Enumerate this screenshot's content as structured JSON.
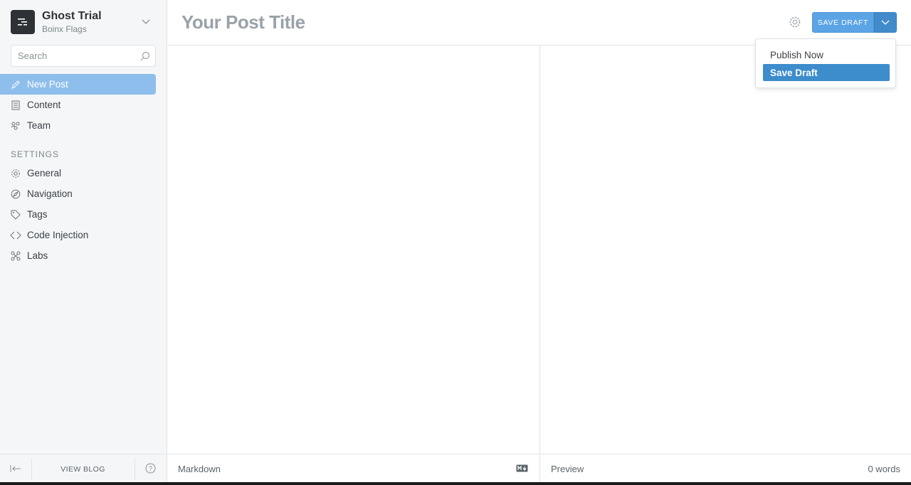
{
  "sidebar": {
    "blog_title": "Ghost Trial",
    "blog_subtitle": "Boinx Flags",
    "search_placeholder": "Search",
    "nav": [
      {
        "label": "New Post",
        "icon": "pencil-icon",
        "active": true
      },
      {
        "label": "Content",
        "icon": "document-icon"
      },
      {
        "label": "Team",
        "icon": "team-icon"
      }
    ],
    "settings_label": "SETTINGS",
    "settings_nav": [
      {
        "label": "General",
        "icon": "gear-icon"
      },
      {
        "label": "Navigation",
        "icon": "compass-icon"
      },
      {
        "label": "Tags",
        "icon": "tag-icon"
      },
      {
        "label": "Code Injection",
        "icon": "code-icon"
      },
      {
        "label": "Labs",
        "icon": "labs-icon"
      }
    ],
    "footer": {
      "view_blog": "VIEW BLOG"
    }
  },
  "editor": {
    "title_placeholder": "Your Post Title",
    "save_button": "SAVE DRAFT",
    "dropdown": {
      "items": [
        "Publish Now",
        "Save Draft"
      ],
      "selected": "Save Draft"
    },
    "footer_left_label": "Markdown",
    "footer_right_label": "Preview",
    "word_count": "0 words"
  },
  "colors": {
    "accent": "#5ba4e5",
    "accent_dark": "#428bca",
    "active_nav": "#8ebeeb",
    "sidebar_bg": "#f4f6f8"
  }
}
